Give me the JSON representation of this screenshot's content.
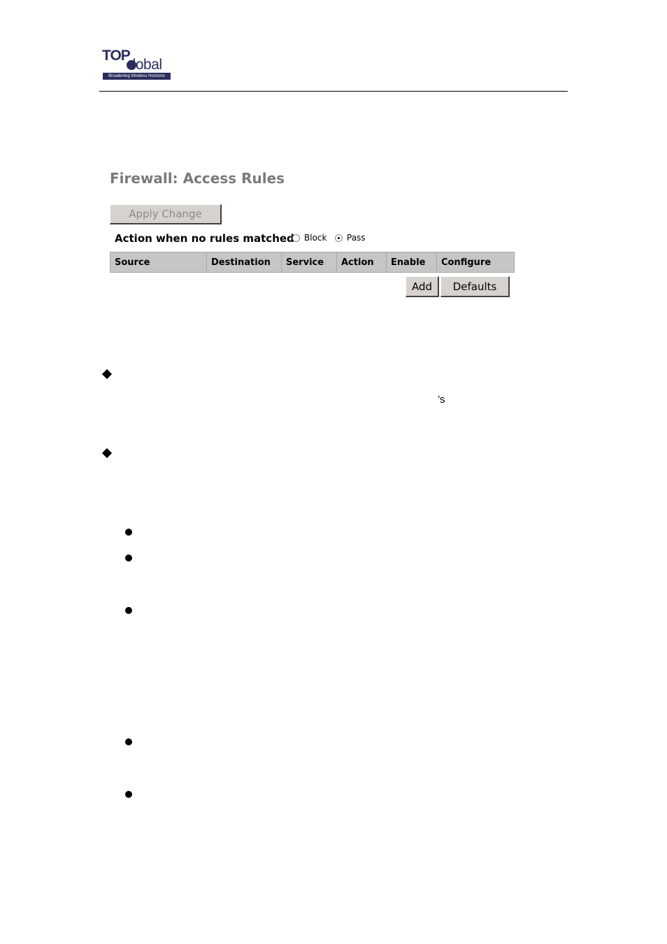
{
  "logo": {
    "top_text": "TOP",
    "global_text": "lobal",
    "tagline": "Broadening Wireless Horizons"
  },
  "page": {
    "title": "Firewall: Access Rules",
    "apply_button": "Apply Change",
    "default_action": {
      "label": "Action when no rules matched:",
      "options": [
        {
          "label": "Block",
          "checked": false
        },
        {
          "label": "Pass",
          "checked": true
        }
      ]
    },
    "table": {
      "columns": [
        "Source",
        "Destination",
        "Service",
        "Action",
        "Enable",
        "Configure"
      ],
      "rows": []
    },
    "add_button": "Add",
    "defaults_button": "Defaults"
  },
  "document": {
    "stray_text": "’s"
  }
}
